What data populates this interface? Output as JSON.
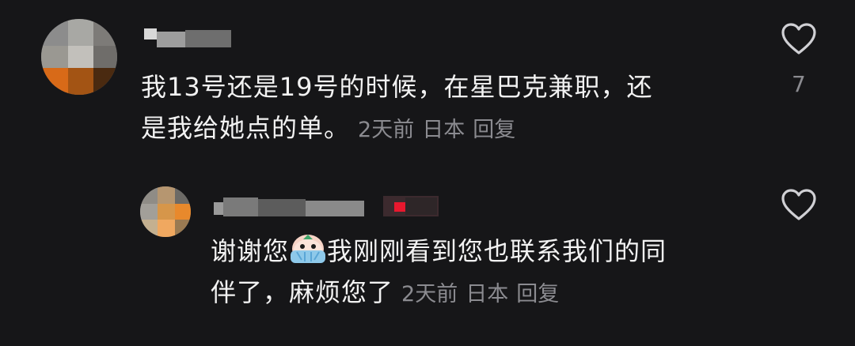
{
  "colors": {
    "background": "#161618",
    "text": "#f2f2f2",
    "meta": "#8b8b90",
    "icon": "#d0d0d4"
  },
  "comments": [
    {
      "text": "我13号还是19号的时候，在星巴克兼职，还是我给她点的单。",
      "line1": "我13号还是19号的时候，在星巴克兼职，还",
      "line2": "是我给她点的单。",
      "time": "2天前",
      "location": "日本",
      "reply_label": "回复",
      "like_count": "7",
      "like_icon": "heart-outline-icon"
    },
    {
      "text": "谢谢您😭我刚刚看到您也联系我们的同伴了，麻烦您了",
      "line1_before_emoji": "谢谢您",
      "emoji": "crying-face-emoji",
      "line1_after_emoji": "我刚刚看到您也联系我们的同",
      "line2": "伴了，麻烦您了",
      "time": "2天前",
      "location": "日本",
      "reply_label": "回复",
      "like_icon": "heart-outline-icon"
    }
  ]
}
